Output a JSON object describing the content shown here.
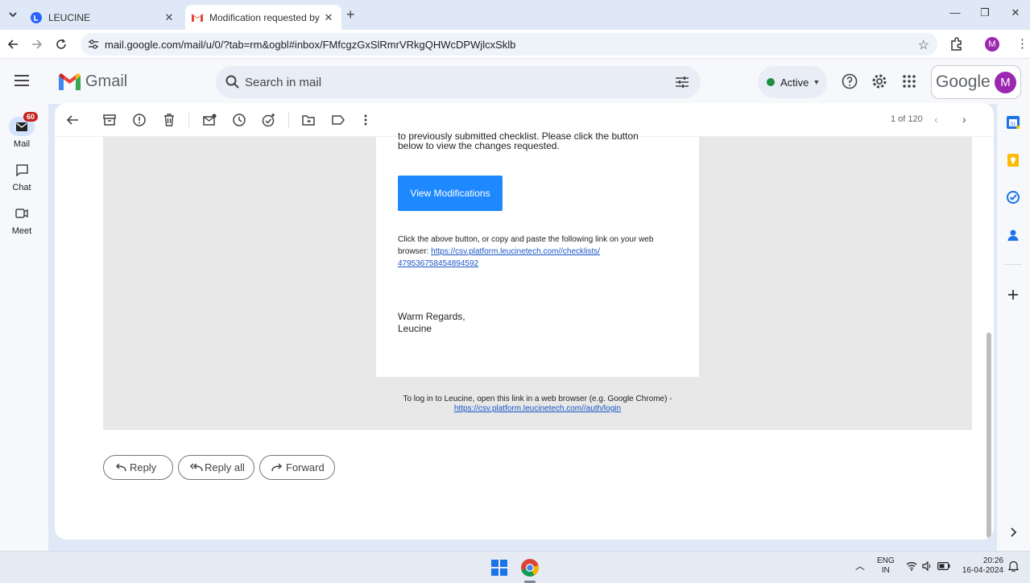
{
  "browser": {
    "tabs": [
      {
        "title": "LEUCINE",
        "active": false
      },
      {
        "title": "Modification requested by Revi",
        "active": true
      }
    ],
    "url": "mail.google.com/mail/u/0/?tab=rm&ogbl#inbox/FMfcgzGxSlRmrVRkgQHWcDPWjlcxSklb",
    "profile_initial": "M"
  },
  "gmail": {
    "logo_text": "Gmail",
    "search_placeholder": "Search in mail",
    "status_label": "Active",
    "google_text": "Google",
    "avatar_initial": "M",
    "rail": [
      {
        "label": "Mail",
        "badge": "60"
      },
      {
        "label": "Chat"
      },
      {
        "label": "Meet"
      }
    ],
    "pager": "1 of 120"
  },
  "email": {
    "cut_line": "to previously submitted checklist. Please click the button",
    "line_view": "below to view the changes requested.",
    "button_label": "View Modifications",
    "copy_text": "Click the above button, or copy and paste the following link on your web",
    "copy_text_2": "browser:",
    "link_part1": "https://csv.platform.leucinetech.com//checklists/",
    "link_part2": "479536758454894592",
    "regards": "Warm Regards,",
    "signature": "Leucine",
    "footer_text": "To log in to Leucine, open this link in a web browser (e.g. Google Chrome) -",
    "footer_link": "https://csv.platform.leucinetech.com//auth/login"
  },
  "actions": {
    "reply": "Reply",
    "reply_all": "Reply all",
    "forward": "Forward"
  },
  "taskbar": {
    "lang_top": "ENG",
    "lang_bottom": "IN",
    "time": "20:26",
    "date": "16-04-2024"
  },
  "colors": {
    "accent_button": "#1e88ff",
    "badge": "#c5221f",
    "status_dot": "#1e8e3e",
    "profile": "#9c27b0"
  }
}
